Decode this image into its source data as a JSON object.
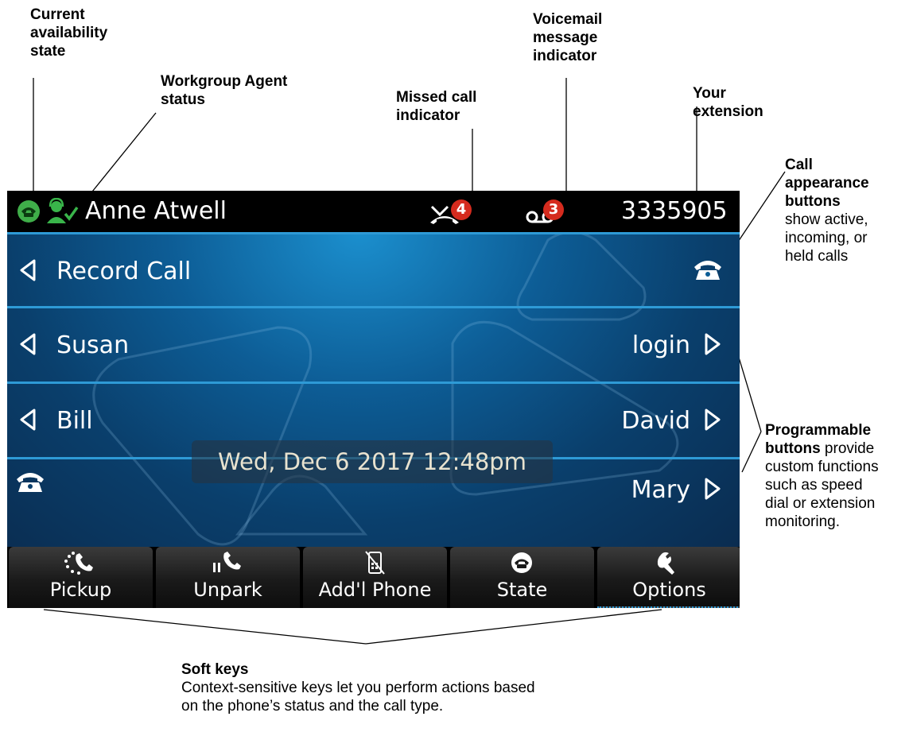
{
  "callouts": {
    "availability": [
      "Current",
      "availability",
      "state"
    ],
    "agent": [
      "Workgroup Agent",
      "status"
    ],
    "missed": [
      "Missed call",
      "indicator"
    ],
    "voicemail": [
      "Voicemail",
      "message",
      "indicator"
    ],
    "extension": [
      "Your",
      "extension"
    ],
    "call_appearance": {
      "bold": [
        "Call",
        "appearance",
        "buttons"
      ],
      "normal": [
        "show active,",
        "incoming, or",
        "held calls"
      ]
    },
    "programmable": {
      "bold1": "Programmable",
      "bold2": "buttons",
      "rest": " provide",
      "lines": [
        "custom functions",
        "such as speed",
        "dial or extension",
        "monitoring."
      ]
    },
    "softkeys": {
      "title": "Soft keys",
      "lines": [
        "Context-sensitive keys let you perform actions based",
        "on the phone’s status and the call type."
      ]
    }
  },
  "phone": {
    "status_bar": {
      "user_name": "Anne Atwell",
      "missed_count": "4",
      "voicemail_count": "3",
      "extension": "3335905",
      "colors": {
        "availability": "#3fae49",
        "agent": "#39b54a",
        "badge": "#d52b1e"
      }
    },
    "rows": [
      {
        "left": "Record Call",
        "right": ""
      },
      {
        "left": "Susan",
        "right": "login"
      },
      {
        "left": "Bill",
        "right": "David"
      },
      {
        "left": "",
        "right": "Mary"
      }
    ],
    "datetime": "Wed, Dec 6 2017 12:48pm",
    "softkeys": [
      {
        "label": "Pickup",
        "icon": "pickup-icon"
      },
      {
        "label": "Unpark",
        "icon": "unpark-icon"
      },
      {
        "label": "Add'l Phone",
        "icon": "addl-phone-icon"
      },
      {
        "label": "State",
        "icon": "state-icon"
      },
      {
        "label": "Options",
        "icon": "wrench-icon"
      }
    ]
  }
}
